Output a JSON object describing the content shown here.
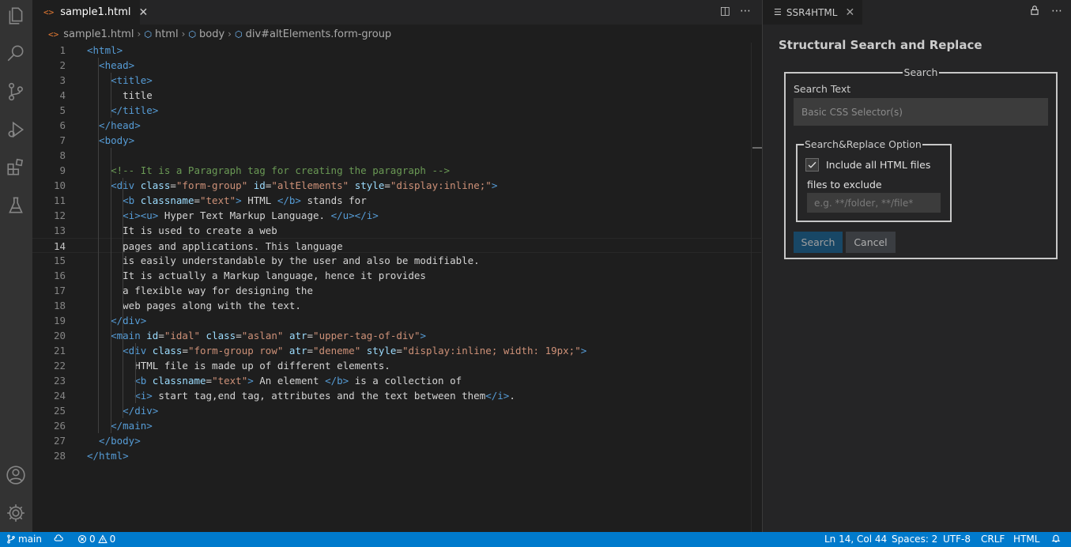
{
  "editor": {
    "tab_label": "sample1.html",
    "tab_close": "✕",
    "breadcrumb": [
      "sample1.html",
      "html",
      "body",
      "div#altElements.form-group"
    ],
    "current_line": 14
  },
  "code_lines": [
    [
      {
        "c": "t-tag",
        "t": "<html>"
      }
    ],
    [
      {
        "c": "t-tag",
        "t": "  <head>"
      }
    ],
    [
      {
        "c": "t-tag",
        "t": "    <title>"
      }
    ],
    [
      {
        "c": "t-txt",
        "t": "      title"
      }
    ],
    [
      {
        "c": "t-tag",
        "t": "    </title>"
      }
    ],
    [
      {
        "c": "t-tag",
        "t": "  </head>"
      }
    ],
    [
      {
        "c": "t-tag",
        "t": "  <body>"
      }
    ],
    [],
    [
      {
        "c": "t-com",
        "t": "    <!-- It is a Paragraph tag for creating the paragraph -->"
      }
    ],
    [
      {
        "c": "t-tag",
        "t": "    <div "
      },
      {
        "c": "t-attr",
        "t": "class"
      },
      {
        "c": "t-txt",
        "t": "="
      },
      {
        "c": "t-str",
        "t": "\"form-group\""
      },
      {
        "c": "t-txt",
        "t": " "
      },
      {
        "c": "t-attr",
        "t": "id"
      },
      {
        "c": "t-txt",
        "t": "="
      },
      {
        "c": "t-str",
        "t": "\"altElements\""
      },
      {
        "c": "t-txt",
        "t": " "
      },
      {
        "c": "t-attr",
        "t": "style"
      },
      {
        "c": "t-txt",
        "t": "="
      },
      {
        "c": "t-str",
        "t": "\"display:inline;\""
      },
      {
        "c": "t-tag",
        "t": ">"
      }
    ],
    [
      {
        "c": "t-tag",
        "t": "      <b "
      },
      {
        "c": "t-attr",
        "t": "classname"
      },
      {
        "c": "t-txt",
        "t": "="
      },
      {
        "c": "t-str",
        "t": "\"text\""
      },
      {
        "c": "t-tag",
        "t": ">"
      },
      {
        "c": "t-txt",
        "t": " HTML "
      },
      {
        "c": "t-tag",
        "t": "</b>"
      },
      {
        "c": "t-txt",
        "t": " stands for"
      }
    ],
    [
      {
        "c": "t-tag",
        "t": "      <i><u>"
      },
      {
        "c": "t-txt",
        "t": " Hyper Text Markup Language. "
      },
      {
        "c": "t-tag",
        "t": "</u></i>"
      }
    ],
    [
      {
        "c": "t-txt",
        "t": "      It is used to create a web"
      }
    ],
    [
      {
        "c": "t-txt",
        "t": "      pages and applications. This language"
      }
    ],
    [
      {
        "c": "t-txt",
        "t": "      is easily understandable by the user and also be modifiable."
      }
    ],
    [
      {
        "c": "t-txt",
        "t": "      It is actually a Markup language, hence it provides"
      }
    ],
    [
      {
        "c": "t-txt",
        "t": "      a flexible way for designing the"
      }
    ],
    [
      {
        "c": "t-txt",
        "t": "      web pages along with the text."
      }
    ],
    [
      {
        "c": "t-tag",
        "t": "    </div>"
      }
    ],
    [
      {
        "c": "t-tag",
        "t": "    <main "
      },
      {
        "c": "t-attr",
        "t": "id"
      },
      {
        "c": "t-txt",
        "t": "="
      },
      {
        "c": "t-str",
        "t": "\"idal\""
      },
      {
        "c": "t-txt",
        "t": " "
      },
      {
        "c": "t-attr",
        "t": "class"
      },
      {
        "c": "t-txt",
        "t": "="
      },
      {
        "c": "t-str",
        "t": "\"aslan\""
      },
      {
        "c": "t-txt",
        "t": " "
      },
      {
        "c": "t-attr",
        "t": "atr"
      },
      {
        "c": "t-txt",
        "t": "="
      },
      {
        "c": "t-str",
        "t": "\"upper-tag-of-div\""
      },
      {
        "c": "t-tag",
        "t": ">"
      }
    ],
    [
      {
        "c": "t-tag",
        "t": "      <div "
      },
      {
        "c": "t-attr",
        "t": "class"
      },
      {
        "c": "t-txt",
        "t": "="
      },
      {
        "c": "t-str",
        "t": "\"form-group row\""
      },
      {
        "c": "t-txt",
        "t": " "
      },
      {
        "c": "t-attr",
        "t": "atr"
      },
      {
        "c": "t-txt",
        "t": "="
      },
      {
        "c": "t-str",
        "t": "\"deneme\""
      },
      {
        "c": "t-txt",
        "t": " "
      },
      {
        "c": "t-attr",
        "t": "style"
      },
      {
        "c": "t-txt",
        "t": "="
      },
      {
        "c": "t-str",
        "t": "\"display:inline; width: 19px;\""
      },
      {
        "c": "t-tag",
        "t": ">"
      }
    ],
    [
      {
        "c": "t-txt",
        "t": "        HTML file is made up of different elements."
      }
    ],
    [
      {
        "c": "t-tag",
        "t": "        <b "
      },
      {
        "c": "t-attr",
        "t": "classname"
      },
      {
        "c": "t-txt",
        "t": "="
      },
      {
        "c": "t-str",
        "t": "\"text\""
      },
      {
        "c": "t-tag",
        "t": ">"
      },
      {
        "c": "t-txt",
        "t": " An element "
      },
      {
        "c": "t-tag",
        "t": "</b>"
      },
      {
        "c": "t-txt",
        "t": " is a collection of"
      }
    ],
    [
      {
        "c": "t-tag",
        "t": "        <i>"
      },
      {
        "c": "t-txt",
        "t": " start tag,end tag, attributes and the text between them"
      },
      {
        "c": "t-tag",
        "t": "</i>"
      },
      {
        "c": "t-txt",
        "t": "."
      }
    ],
    [
      {
        "c": "t-tag",
        "t": "      </div>"
      }
    ],
    [
      {
        "c": "t-tag",
        "t": "    </main>"
      }
    ],
    [
      {
        "c": "t-tag",
        "t": "  </body>"
      }
    ],
    [
      {
        "c": "t-tag",
        "t": "</html>"
      }
    ]
  ],
  "panel": {
    "tab_label": "SSR4HTML",
    "tab_close": "✕",
    "title": "Structural Search and Replace",
    "search_legend": "Search",
    "search_text_label": "Search Text",
    "search_placeholder": "Basic CSS Selector(s)",
    "option_legend": "Search&Replace Option",
    "include_all_label": "Include all HTML files",
    "include_all_checked": true,
    "exclude_label": "files to exclude",
    "exclude_placeholder": "e.g. **/folder, **/file*",
    "search_button": "Search",
    "cancel_button": "Cancel"
  },
  "status": {
    "branch": "main",
    "errors": "0",
    "warnings": "0",
    "position": "Ln 14, Col 44",
    "spaces": "Spaces: 2",
    "encoding": "UTF-8",
    "eol": "CRLF",
    "language": "HTML"
  },
  "colors": {
    "statusbar": "#007acc",
    "tag": "#569cd6",
    "attr": "#9cdcfe",
    "string": "#ce9178",
    "comment": "#6a9955"
  }
}
